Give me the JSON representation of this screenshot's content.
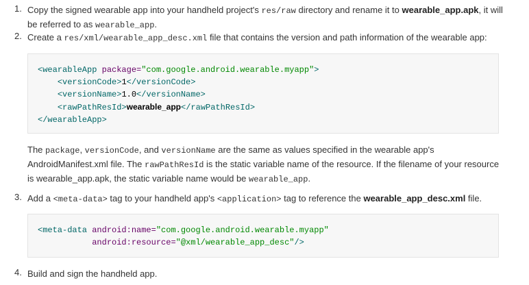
{
  "step1": {
    "number": "1.",
    "text_a": "Copy the signed wearable app into your handheld project's ",
    "code_a": "res/raw",
    "text_b": " directory and rename it to ",
    "bold_a": "wearable_app.apk",
    "text_c": ", it will be referred to as ",
    "code_b": "wearable_app",
    "text_d": "."
  },
  "step2": {
    "number": "2.",
    "text_a": "Create a ",
    "code_a": "res/xml/wearable_app_desc.xml",
    "text_b": " file that contains the version and path information of the wearable app:",
    "code_lines": {
      "l1_open": "<wearableApp",
      "l1_attr": " package=",
      "l1_val": "\"com.google.android.wearable.myapp\"",
      "l1_close": ">",
      "l2_open": "<versionCode>",
      "l2_val": "1",
      "l2_close": "</versionCode>",
      "l3_open": "<versionName>",
      "l3_val": "1.0",
      "l3_close": "</versionName>",
      "l4_open": "<rawPathResId>",
      "l4_val": "wearable_app",
      "l4_close": "</rawPathResId>",
      "l5": "</wearableApp>"
    },
    "para_a": "The ",
    "para_code_a": "package",
    "para_b": ", ",
    "para_code_b": "versionCode",
    "para_c": ", and ",
    "para_code_c": "versionName",
    "para_d": " are the same as values specified in the wearable app's AndroidManifest.xml file. The ",
    "para_code_d": "rawPathResId",
    "para_e": " is the static variable name of the resource. If the filename of your resource is wearable_app.apk, the static variable name would be ",
    "para_code_e": "wearable_app",
    "para_f": "."
  },
  "step3": {
    "number": "3.",
    "text_a": "Add a ",
    "code_a": "<meta-data>",
    "text_b": " tag to your handheld app's ",
    "code_b": "<application>",
    "text_c": " tag to reference the ",
    "bold_a": "wearable_app_desc.xml",
    "text_d": " file.",
    "code_lines": {
      "l1_open": "<meta-data",
      "l1_attr": " android:name=",
      "l1_val": "\"com.google.android.wearable.myapp\"",
      "l2_attr": "android:resource=",
      "l2_val": "\"@xml/wearable_app_desc\"",
      "l2_close": "/>"
    }
  },
  "step4": {
    "number": "4.",
    "text": "Build and sign the handheld app."
  }
}
